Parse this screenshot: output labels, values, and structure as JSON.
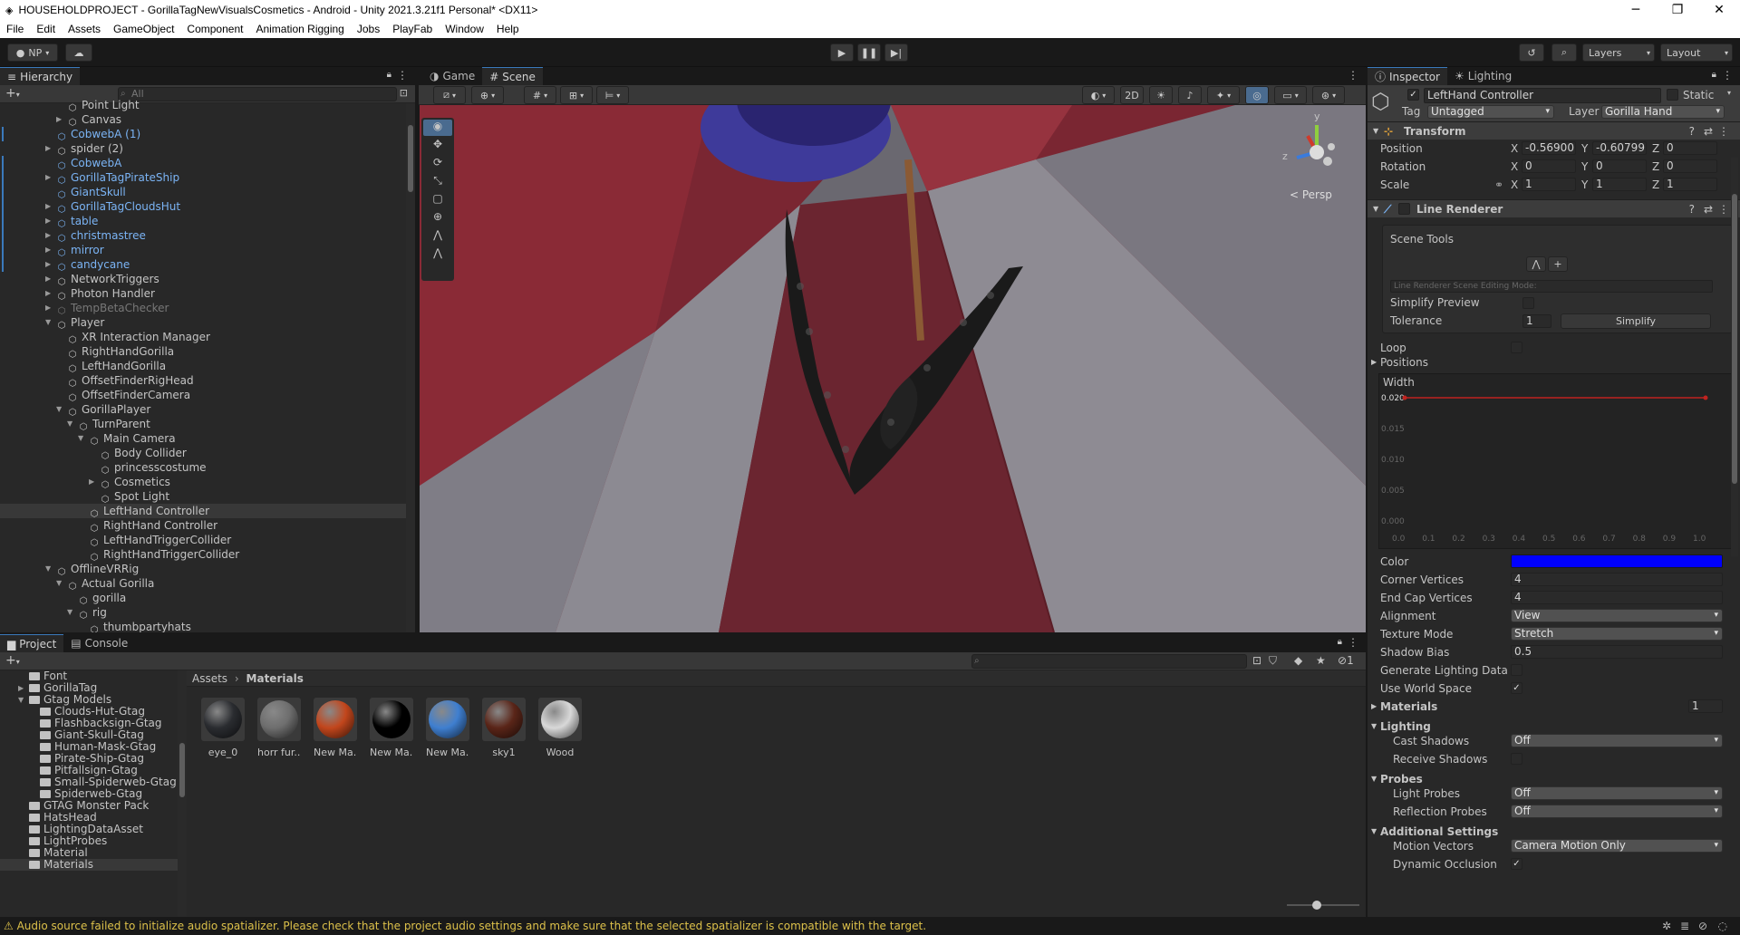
{
  "window": {
    "title": "HOUSEHOLDPROJECT - GorillaTagNewVisualsCosmetics - Android - Unity 2021.3.21f1 Personal* <DX11>"
  },
  "menu": [
    "File",
    "Edit",
    "Assets",
    "GameObject",
    "Component",
    "Animation Rigging",
    "Jobs",
    "PlayFab",
    "Window",
    "Help"
  ],
  "toolbar": {
    "account": "NP",
    "layers": "Layers",
    "layout": "Layout"
  },
  "hierarchy": {
    "tab": "Hierarchy",
    "search_placeholder": "All",
    "items": [
      {
        "label": "Point Light",
        "indent": 4,
        "style": "normal",
        "arrow": ""
      },
      {
        "label": "Canvas",
        "indent": 4,
        "style": "normal",
        "arrow": "right"
      },
      {
        "label": "CobwebA (1)",
        "indent": 3,
        "style": "blue",
        "arrow": ""
      },
      {
        "label": "spider (2)",
        "indent": 3,
        "style": "normal",
        "arrow": "right"
      },
      {
        "label": "CobwebA",
        "indent": 3,
        "style": "blue",
        "arrow": ""
      },
      {
        "label": "GorillaTagPirateShip",
        "indent": 3,
        "style": "blue",
        "arrow": "right"
      },
      {
        "label": "GiantSkull",
        "indent": 3,
        "style": "blue",
        "arrow": ""
      },
      {
        "label": "GorillaTagCloudsHut",
        "indent": 3,
        "style": "blue",
        "arrow": "right"
      },
      {
        "label": "table",
        "indent": 3,
        "style": "blue",
        "arrow": "right",
        "more": true
      },
      {
        "label": "christmastree",
        "indent": 3,
        "style": "blue",
        "arrow": "right",
        "more": true
      },
      {
        "label": "mirror",
        "indent": 3,
        "style": "blue",
        "arrow": "right",
        "more": true
      },
      {
        "label": "candycane",
        "indent": 3,
        "style": "blue",
        "arrow": "right",
        "more": true
      },
      {
        "label": "NetworkTriggers",
        "indent": 3,
        "style": "normal",
        "arrow": "right"
      },
      {
        "label": "Photon Handler",
        "indent": 3,
        "style": "normal",
        "arrow": "right"
      },
      {
        "label": "TempBetaChecker",
        "indent": 3,
        "style": "gray",
        "arrow": "right"
      },
      {
        "label": "Player",
        "indent": 3,
        "style": "normal",
        "arrow": "down"
      },
      {
        "label": "XR Interaction Manager",
        "indent": 4,
        "style": "normal",
        "arrow": ""
      },
      {
        "label": "RightHandGorilla",
        "indent": 4,
        "style": "normal",
        "arrow": ""
      },
      {
        "label": "LeftHandGorilla",
        "indent": 4,
        "style": "normal",
        "arrow": ""
      },
      {
        "label": "OffsetFinderRigHead",
        "indent": 4,
        "style": "normal",
        "arrow": ""
      },
      {
        "label": "OffsetFinderCamera",
        "indent": 4,
        "style": "normal",
        "arrow": ""
      },
      {
        "label": "GorillaPlayer",
        "indent": 4,
        "style": "normal",
        "arrow": "down"
      },
      {
        "label": "TurnParent",
        "indent": 5,
        "style": "normal",
        "arrow": "down"
      },
      {
        "label": "Main Camera",
        "indent": 6,
        "style": "normal",
        "arrow": "down"
      },
      {
        "label": "Body Collider",
        "indent": 7,
        "style": "normal",
        "arrow": ""
      },
      {
        "label": "princesscostume",
        "indent": 7,
        "style": "normal",
        "arrow": ""
      },
      {
        "label": "Cosmetics",
        "indent": 7,
        "style": "normal",
        "arrow": "right"
      },
      {
        "label": "Spot Light",
        "indent": 7,
        "style": "normal",
        "arrow": ""
      },
      {
        "label": "LeftHand Controller",
        "indent": 6,
        "style": "selected",
        "arrow": ""
      },
      {
        "label": "RightHand Controller",
        "indent": 6,
        "style": "normal",
        "arrow": ""
      },
      {
        "label": "LeftHandTriggerCollider",
        "indent": 6,
        "style": "normal",
        "arrow": ""
      },
      {
        "label": "RightHandTriggerCollider",
        "indent": 6,
        "style": "normal",
        "arrow": ""
      },
      {
        "label": "OfflineVRRig",
        "indent": 3,
        "style": "normal",
        "arrow": "down"
      },
      {
        "label": "Actual Gorilla",
        "indent": 4,
        "style": "normal",
        "arrow": "down"
      },
      {
        "label": "gorilla",
        "indent": 5,
        "style": "normal",
        "arrow": ""
      },
      {
        "label": "rig",
        "indent": 5,
        "style": "normal",
        "arrow": "down"
      },
      {
        "label": "thumbpartyhats",
        "indent": 6,
        "style": "normal",
        "arrow": ""
      }
    ]
  },
  "scene_tabs": [
    {
      "label": "Game",
      "icon": "gamepad-icon",
      "active": false
    },
    {
      "label": "Scene",
      "icon": "grid-icon",
      "active": true
    }
  ],
  "scene": {
    "twod": "2D",
    "persp": "< Persp",
    "gizmo_y": "y",
    "gizmo_z": "z"
  },
  "project": {
    "tabs": [
      {
        "label": "Project",
        "active": true
      },
      {
        "label": "Console",
        "active": false
      }
    ],
    "breadcrumb": [
      "Assets",
      "Materials"
    ],
    "hidden_count": "1",
    "folders": [
      {
        "label": "Font",
        "indent": 1,
        "arrow": ""
      },
      {
        "label": "GorillaTag",
        "indent": 1,
        "arrow": "right"
      },
      {
        "label": "Gtag Models",
        "indent": 1,
        "arrow": "down"
      },
      {
        "label": "Clouds-Hut-Gtag",
        "indent": 2,
        "arrow": ""
      },
      {
        "label": "Flashbacksign-Gtag",
        "indent": 2,
        "arrow": ""
      },
      {
        "label": "Giant-Skull-Gtag",
        "indent": 2,
        "arrow": ""
      },
      {
        "label": "Human-Mask-Gtag",
        "indent": 2,
        "arrow": ""
      },
      {
        "label": "Pirate-Ship-Gtag",
        "indent": 2,
        "arrow": ""
      },
      {
        "label": "Pitfallsign-Gtag",
        "indent": 2,
        "arrow": ""
      },
      {
        "label": "Small-Spiderweb-Gtag",
        "indent": 2,
        "arrow": ""
      },
      {
        "label": "Spiderweb-Gtag",
        "indent": 2,
        "arrow": ""
      },
      {
        "label": "GTAG Monster Pack",
        "indent": 1,
        "arrow": ""
      },
      {
        "label": "HatsHead",
        "indent": 1,
        "arrow": ""
      },
      {
        "label": "LightingDataAsset",
        "indent": 1,
        "arrow": ""
      },
      {
        "label": "LightProbes",
        "indent": 1,
        "arrow": ""
      },
      {
        "label": "Material",
        "indent": 1,
        "arrow": ""
      },
      {
        "label": "Materials",
        "indent": 1,
        "arrow": "",
        "selected": true
      }
    ],
    "assets": [
      {
        "label": "eye_0",
        "color": "#2a2c30"
      },
      {
        "label": "horr fur...",
        "color": "#6e6e6e"
      },
      {
        "label": "New Ma...",
        "color": "#c2461c"
      },
      {
        "label": "New Ma...",
        "color": "#000000"
      },
      {
        "label": "New Ma...",
        "color": "#3f7fd0"
      },
      {
        "label": "sky1",
        "color": "#5a2518"
      },
      {
        "label": "Wood",
        "color": "#d8d8d8"
      }
    ]
  },
  "inspector": {
    "tabs": [
      {
        "label": "Inspector",
        "active": true
      },
      {
        "label": "Lighting",
        "active": false
      }
    ],
    "object_name": "LeftHand Controller",
    "static_label": "Static",
    "tag_label": "Tag",
    "tag_value": "Untagged",
    "layer_label": "Layer",
    "layer_value": "Gorilla Hand",
    "transform": {
      "title": "Transform",
      "position": {
        "label": "Position",
        "x": "-0.56900",
        "y": "-0.60799",
        "z": "0"
      },
      "rotation": {
        "label": "Rotation",
        "x": "0",
        "y": "0",
        "z": "0"
      },
      "scale": {
        "label": "Scale",
        "x": "1",
        "y": "1",
        "z": "1"
      }
    },
    "line_renderer": {
      "title": "Line Renderer",
      "scene_tools": "Scene Tools",
      "editing_mode": "Line Renderer Scene Editing Mode:",
      "simplify_preview": "Simplify Preview",
      "tolerance_label": "Tolerance",
      "tolerance_value": "1",
      "simplify_button": "Simplify",
      "loop": "Loop",
      "positions": "Positions",
      "width_label": "Width",
      "width_yticks": [
        "0.020",
        "0.015",
        "0.010",
        "0.005",
        "0.000"
      ],
      "width_xticks": [
        "0.0",
        "0.1",
        "0.2",
        "0.3",
        "0.4",
        "0.5",
        "0.6",
        "0.7",
        "0.8",
        "0.9",
        "1.0"
      ],
      "width_curve_value": 0.02,
      "color_label": "Color",
      "color_value": "#0000ff",
      "corner_vertices_label": "Corner Vertices",
      "corner_vertices": "4",
      "end_cap_vertices_label": "End Cap Vertices",
      "end_cap_vertices": "4",
      "alignment_label": "Alignment",
      "alignment": "View",
      "texture_mode_label": "Texture Mode",
      "texture_mode": "Stretch",
      "shadow_bias_label": "Shadow Bias",
      "shadow_bias": "0.5",
      "gen_lighting_label": "Generate Lighting Data",
      "world_space_label": "Use World Space",
      "materials_label": "Materials",
      "materials_count": "1",
      "lighting_label": "Lighting",
      "cast_shadows_label": "Cast Shadows",
      "cast_shadows": "Off",
      "receive_shadows_label": "Receive Shadows",
      "probes_label": "Probes",
      "light_probes_label": "Light Probes",
      "light_probes": "Off",
      "reflection_probes_label": "Reflection Probes",
      "reflection_probes": "Off",
      "additional_label": "Additional Settings",
      "motion_vectors_label": "Motion Vectors",
      "motion_vectors": "Camera Motion Only",
      "dynamic_occlusion_label": "Dynamic Occlusion"
    }
  },
  "status": {
    "message": "Audio source failed to initialize audio spatializer. Please check that the project audio settings and make sure that the selected spatializer is compatible with the target."
  }
}
